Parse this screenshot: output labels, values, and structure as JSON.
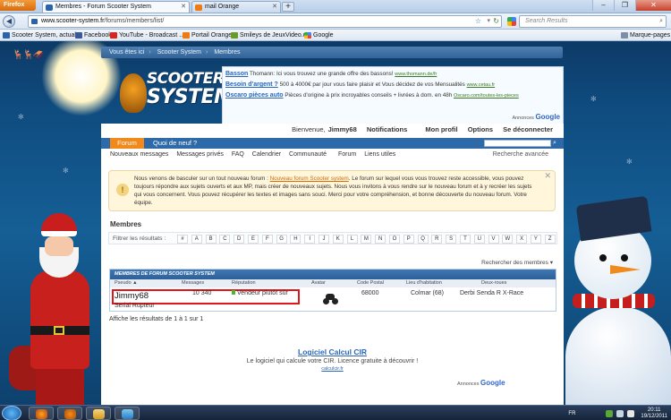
{
  "browser": {
    "app_button": "Firefox",
    "tabs": [
      {
        "title": "Membres - Forum Scooter System"
      },
      {
        "title": "mail Orange"
      }
    ],
    "url_host": "www.scooter-system.fr",
    "url_path": "/forums/members/list/",
    "search_placeholder": "Search Results",
    "bookmarks": [
      {
        "label": "Scooter System, actual..."
      },
      {
        "label": "Facebook"
      },
      {
        "label": "YouTube - Broadcast ..."
      },
      {
        "label": "Portail Orange"
      },
      {
        "label": "Smileys de JeuxVideo.c..."
      },
      {
        "label": "Google"
      }
    ],
    "bookmarks_menu": "Marque-pages"
  },
  "breadcrumb": [
    "Vous êtes ici",
    "Scooter System",
    "Membres"
  ],
  "logo": {
    "line1": "SCOOTER",
    "line2": "SYSTEM"
  },
  "ads": [
    {
      "title": "Basson",
      "text": "Thomann: Ici vous trouvez une grande offre des bassons!",
      "url": "www.thomann.de/fr"
    },
    {
      "title": "Besoin d'argent ?",
      "text": "500 à 4000€ par jour vous faire plaisir et Vous décidez de vos Mensualités",
      "url": "www.cetau.fr"
    },
    {
      "title": "Oscaro pièces auto",
      "text": "Pièces d'origine à prix incroyables conseils + livrées à dom. en 48h",
      "url": "Oscaro.com/toutes-les-pieces"
    }
  ],
  "ads_by": {
    "prefix": "Annonces",
    "brand": "Google"
  },
  "userbar": {
    "welcome": "Bienvenue,",
    "username": "Jimmy68",
    "links": [
      "Notifications",
      "Mon profil",
      "Options",
      "Se déconnecter"
    ]
  },
  "navtabs": [
    "Forum",
    "Quoi de neuf ?"
  ],
  "subnav": {
    "links": [
      "Nouveaux messages",
      "Messages privés",
      "FAQ",
      "Calendrier",
      "Communauté",
      "Forum",
      "Liens utiles"
    ],
    "advanced_search": "Recherche avancée"
  },
  "notice": {
    "text_before": "Nous venons de basculer sur un tout nouveau forum :",
    "link": "Nouveau forum Scooter system",
    "text_after": ". Le forum sur lequel vous vous trouvez reste accessible, vous pouvez toujours répondre aux sujets ouverts et aux MP, mais créer de nouveaux sujets. Nous vous invitons à vous rendre sur le nouveau forum et à y recréer les sujets qui vous concernent. Vous pouvez récupérer les textes et images sans souci. Merci pour votre compréhension, et bonne découverte du nouveau forum. Votre équipe."
  },
  "members": {
    "title": "Membres",
    "filter_label": "Filtrer les résultats :",
    "letters": [
      "#",
      "A",
      "B",
      "C",
      "D",
      "E",
      "F",
      "G",
      "H",
      "I",
      "J",
      "K",
      "L",
      "M",
      "N",
      "O",
      "P",
      "Q",
      "R",
      "S",
      "T",
      "U",
      "V",
      "W",
      "X",
      "Y",
      "Z"
    ],
    "sort_link": "Rechercher des membres",
    "table_caption": "Membres de Forum Scooter System",
    "columns": [
      "Pseudo ▲",
      "Messages",
      "Réputation",
      "Avatar",
      "Code Postal",
      "Lieu d'habitation",
      "Deux-roues"
    ],
    "row": {
      "username": "Jimmy68",
      "rank": "Serial Rupteur",
      "messages": "10 340",
      "reputation": "Vendeur plutôt sûr",
      "postal": "68000",
      "place": "Colmar (68)",
      "vehicle": "Derbi Senda R X-Race"
    },
    "results_text": "Affiche les résultats de 1 à 1 sur 1"
  },
  "promo": {
    "title": "Logiciel Calcul CIR",
    "desc": "Le logiciel qui calcule votre CIR. Licence gratuite à découvrir !",
    "url": "calculcir.fr"
  },
  "taskbar": {
    "lang": "FR",
    "time": "20:11",
    "date": "19/12/2011"
  }
}
